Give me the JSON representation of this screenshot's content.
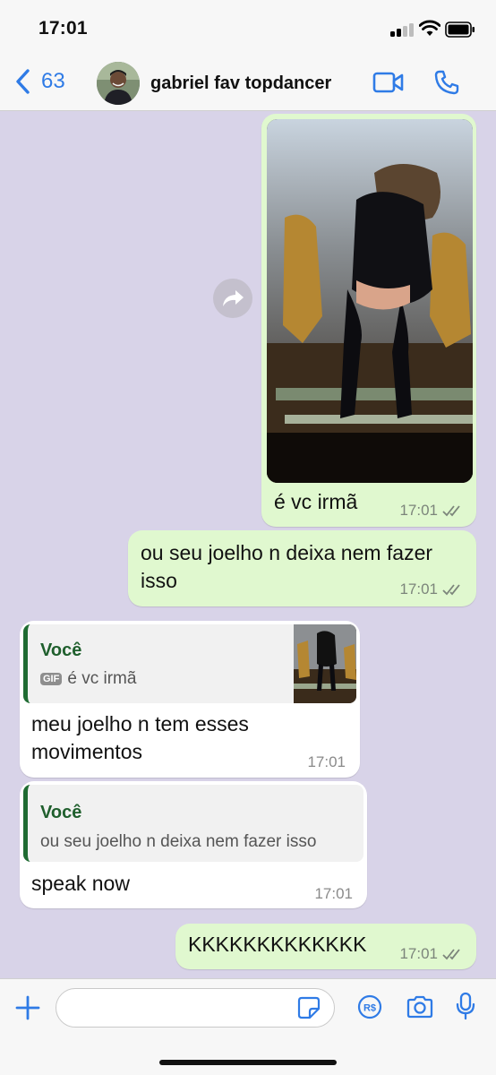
{
  "status_bar": {
    "time": "17:01"
  },
  "header": {
    "back_count": "63",
    "contact_name": "gabriel fav topdancer"
  },
  "messages": [
    {
      "type": "outgoing",
      "media": "gif",
      "text": "é vc irmã",
      "time": "17:01",
      "status": "read"
    },
    {
      "type": "outgoing",
      "text": "ou seu joelho n deixa nem fazer isso",
      "time": "17:01",
      "status": "read"
    },
    {
      "type": "incoming",
      "quote": {
        "author": "Você",
        "badge": "GIF",
        "text": "é vc irmã"
      },
      "text": "meu joelho n tem esses movimentos",
      "time": "17:01"
    },
    {
      "type": "incoming",
      "quote": {
        "author": "Você",
        "text": "ou seu joelho n deixa nem fazer isso"
      },
      "text": "speak now",
      "time": "17:01"
    },
    {
      "type": "outgoing",
      "text": "KKKKKKKKKKKKK",
      "time": "17:01",
      "status": "read"
    }
  ],
  "input": {
    "placeholder": ""
  },
  "icons": {
    "back": "chevron-left-icon",
    "video": "video-camera-icon",
    "phone": "phone-icon",
    "forward": "forward-icon",
    "plus": "plus-icon",
    "sticker": "sticker-icon",
    "payment": "pix-payment-icon",
    "camera": "camera-icon",
    "mic": "microphone-icon"
  },
  "colors": {
    "accent": "#2f7be6",
    "outgoing_bubble": "#e0f8cf",
    "incoming_bubble": "#ffffff",
    "chat_background": "#d8d3e8",
    "quote_author": "#1f5f2d",
    "read_ticks": "#7c857b"
  }
}
